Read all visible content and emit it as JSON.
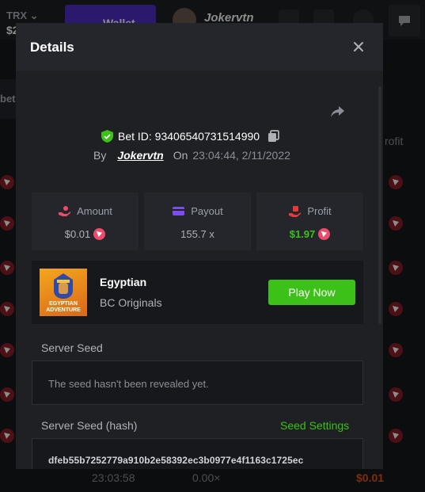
{
  "background": {
    "currency": "TRX",
    "balance": "$2",
    "wallet_label": "Wallet",
    "username": "Jokervtn",
    "left_partial": "bet",
    "right_partial": "rofit",
    "row_time": "23:03:58",
    "row_payout": "0.00×",
    "row_profit": "$0.01"
  },
  "modal": {
    "title": "Details",
    "bet_id_label": "Bet ID: 93406540731514990",
    "by_label": "By",
    "username": "Jokervtn",
    "on_label": "On",
    "date": "23:04:44, 2/11/2022",
    "stats": {
      "amount_label": "Amount",
      "amount_value": "$0.01",
      "payout_label": "Payout",
      "payout_value": "155.7 x",
      "profit_label": "Profit",
      "profit_value": "$1.97"
    },
    "game": {
      "name": "Egyptian",
      "provider": "BC Originals",
      "thumb_line1": "EGYPTIAN",
      "thumb_line2": "ADVENTURE",
      "play_label": "Play Now"
    },
    "server_seed_label": "Server Seed",
    "server_seed_value": "The seed hasn't been revealed yet.",
    "server_seed_hash_label": "Server Seed (hash)",
    "seed_settings_label": "Seed Settings",
    "server_seed_hash_value": "dfeb55b7252779a910b2e58392ec3b0977e4f1163c1725ec"
  },
  "colors": {
    "accent_green": "#3bc117",
    "wallet_purple": "#4d2fc7",
    "coin_red": "#ec4b6a"
  }
}
